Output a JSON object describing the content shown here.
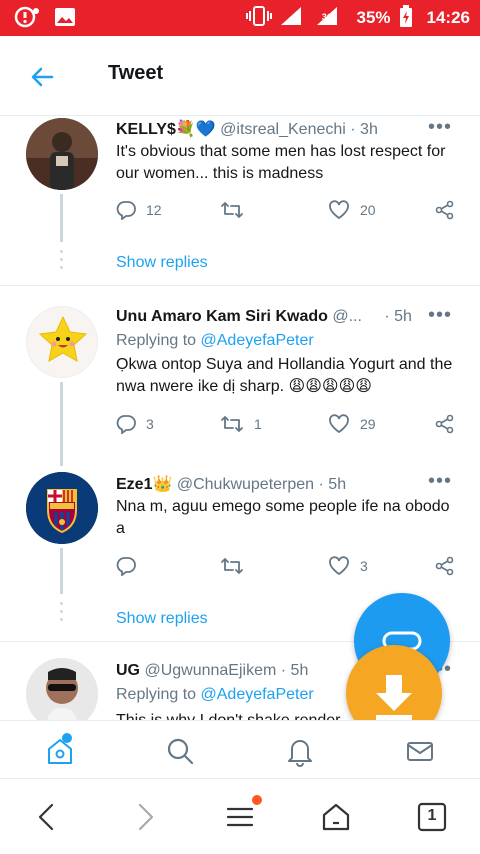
{
  "status_bar": {
    "network": "3G",
    "battery": "35%",
    "time": "14:26"
  },
  "header": {
    "title": "Tweet"
  },
  "tweets": [
    {
      "name": "KELLY$💐💙",
      "handle": "@itsreal_Kenechi",
      "time": "· 3h",
      "replying_prefix": "",
      "replying_to": "",
      "text": "It's obvious that some men has lost respect for our women... this is madness",
      "replies": "12",
      "retweets": "",
      "likes": "20",
      "show_replies": "Show replies"
    },
    {
      "name": "Unu Amaro Kam Siri Kwado",
      "handle": "@...",
      "time": "· 5h",
      "replying_prefix": "Replying to ",
      "replying_to": "@AdeyefaPeter",
      "text": "Ọkwa ontop Suya and Hollandia Yogurt and the nwa nwere ike dị sharp. 😩😩😩😩😩",
      "replies": "3",
      "retweets": "1",
      "likes": "29",
      "show_replies": ""
    },
    {
      "name": "Eze1👑",
      "handle": "@Chukwupeterpen",
      "time": "· 5h",
      "replying_prefix": "",
      "replying_to": "",
      "text": "Nna m, aguu emego some people ife na obodo a",
      "replies": "",
      "retweets": "",
      "likes": "3",
      "show_replies": "Show replies"
    },
    {
      "name": "UG",
      "handle": "@UgwunnaEjikem",
      "time": "· 5h",
      "replying_prefix": "Replying to ",
      "replying_to": "@AdeyefaPeter",
      "text": "This is why I don't shake render",
      "replies": "",
      "retweets": "",
      "likes": "",
      "show_replies": ""
    }
  ],
  "browser_bar": {
    "tab_count": "1"
  },
  "colors": {
    "status_bar": "#e8212b",
    "accent": "#1da1f2",
    "download": "#f5a623"
  }
}
